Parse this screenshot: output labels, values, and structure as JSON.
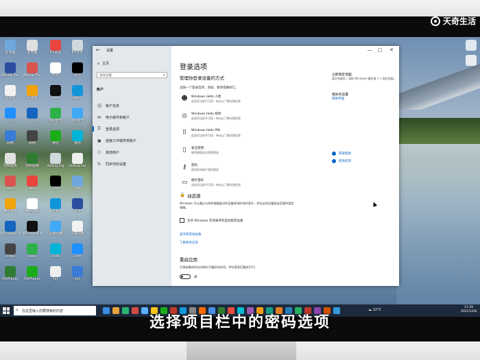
{
  "brand": {
    "text": "天奇生活",
    "big": "天奇"
  },
  "caption": "选择项目栏中的密码选项",
  "window": {
    "title": "设置",
    "controls": [
      "—",
      "□",
      "✕"
    ]
  },
  "sidebar": {
    "home": "主页",
    "search_placeholder": "查找设置",
    "section": "帐户",
    "items": [
      {
        "label": "帐户信息",
        "icon": "person-icon"
      },
      {
        "label": "电子邮件和帐户",
        "icon": "mail-icon"
      },
      {
        "label": "登录选项",
        "icon": "key-icon",
        "active": true
      },
      {
        "label": "连接工作或学校帐户",
        "icon": "briefcase-icon"
      },
      {
        "label": "其他用户",
        "icon": "people-icon"
      },
      {
        "label": "同步你的设置",
        "icon": "sync-icon"
      }
    ]
  },
  "main": {
    "title": "登录选项",
    "subtitle": "管理你登录设备的方式",
    "choose": "选择一个登录选项，添加、更改或删除它。",
    "options": [
      {
        "title": "Windows Hello 人脸",
        "desc": "此选项当前不可用 - 单击以了解详细信息",
        "icon": "face-icon"
      },
      {
        "title": "Windows Hello 指纹",
        "desc": "此选项当前不可用 - 单击以了解详细信息",
        "icon": "fingerprint-icon"
      },
      {
        "title": "Windows Hello PIN",
        "desc": "此选项当前不可用 - 单击以了解详细信息",
        "icon": "pin-icon"
      },
      {
        "title": "安全密钥",
        "desc": "使用物理安全密钥登录",
        "icon": "usb-key-icon"
      },
      {
        "title": "密码",
        "desc": "使用你的帐户密码登录",
        "icon": "password-key-icon"
      },
      {
        "title": "图片密码",
        "desc": "此选项当前不可用 - 单击以了解详细信息",
        "icon": "picture-icon"
      }
    ],
    "dynamic_lock": {
      "title": "动态锁",
      "desc": "Windows 可以通过与你的电脑配对的设备获知你何时离开，并在这些设备超出范围时锁定电脑。",
      "checkbox": "允许 Windows 在你离开时自动锁定设备",
      "links": [
        "蓝牙和其他设备",
        "了解更多信息"
      ]
    },
    "restart_apps": {
      "title": "重启应用",
      "desc": "注销或重启时自动保存可重启的应用，并在登录后重启它们。",
      "toggle": "关"
    }
  },
  "right_column": {
    "lock_head": "立即锁定电脑",
    "lock_text": "离开电脑时，请按 Windows 徽标键 + L 锁定电脑。",
    "related_head": "相关的设置",
    "related_link": "锁屏界面",
    "help_link": "获取帮助",
    "feedback_link": "提供反馈"
  },
  "desktop_icons": [
    "此电脑",
    "Adobe Premiere",
    "回收站",
    "QQ",
    "网络",
    "控制面板",
    "wps",
    "腾讯视频",
    "Microsoft Edge",
    "video",
    "PotPlayer",
    "EV录屏",
    "软件",
    "word",
    "360安全",
    "微信",
    "debug.log",
    "剪映",
    "钉钉",
    "百度网盘",
    "2345",
    "txt"
  ],
  "taskbar": {
    "search_placeholder": "在这里输入你要搜索的内容",
    "weather": "12°C",
    "time": "11:29",
    "date": "2021/12/8"
  },
  "colors": {
    "accent": "#0a64c8",
    "taskbar": "#1d2a3d"
  }
}
